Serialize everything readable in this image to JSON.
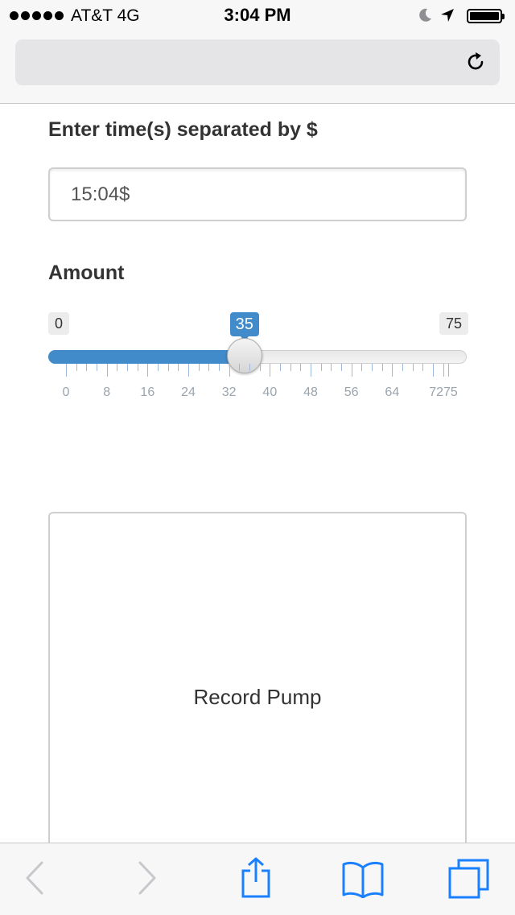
{
  "status_bar": {
    "carrier": "AT&T   4G",
    "time": "3:04 PM",
    "icons": [
      "signal-dots",
      "moon-icon",
      "location-arrow-icon",
      "battery-icon"
    ]
  },
  "browser": {
    "url_text": "",
    "reload_icon": "reload-icon"
  },
  "form": {
    "times_label": "Enter time(s) separated by $",
    "times_value": "15:04$",
    "amount_label": "Amount",
    "slider": {
      "min": 0,
      "max": 75,
      "value": 35,
      "min_label": "0",
      "max_label": "75",
      "value_label": "35",
      "grid_labels": [
        "0",
        "8",
        "16",
        "24",
        "32",
        "40",
        "48",
        "56",
        "64",
        "7275"
      ]
    },
    "submit_label": "Record Pump"
  },
  "toolbar": {
    "items": [
      "back-icon",
      "forward-icon",
      "share-icon",
      "bookmarks-icon",
      "tabs-icon"
    ]
  },
  "colors": {
    "accent": "#428bca",
    "toolbar_icon": "#1a80ff",
    "disabled_icon": "#c7c7cc"
  }
}
